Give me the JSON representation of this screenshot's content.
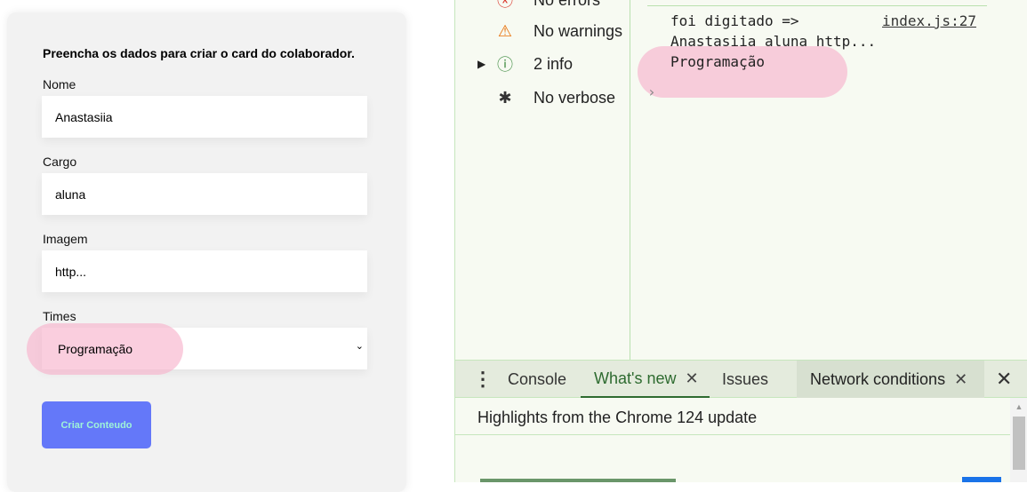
{
  "form": {
    "title": "Preencha os dados para criar o card do colaborador.",
    "fields": [
      {
        "label": "Nome",
        "value": "Anastasiia"
      },
      {
        "label": "Cargo",
        "value": "aluna"
      },
      {
        "label": "Imagem",
        "value": "http..."
      }
    ],
    "select": {
      "label": "Times",
      "value": "Programação"
    },
    "submit": "Criar Conteudo"
  },
  "devtools": {
    "sidebar": [
      {
        "icon": "error-icon",
        "label": "No errors"
      },
      {
        "icon": "warning-icon",
        "label": "No warnings"
      },
      {
        "icon": "info-icon",
        "label": "2 info"
      },
      {
        "icon": "bug-icon",
        "label": "No verbose"
      }
    ],
    "console": {
      "line1": "foi digitado =>",
      "source": "index.js:27",
      "line2": "Anastasiia aluna http...",
      "line3": "Programação"
    },
    "tabs": [
      {
        "label": "Console"
      },
      {
        "label": "What's new",
        "active": true
      },
      {
        "label": "Issues"
      },
      {
        "label": "Network conditions"
      }
    ],
    "drawer_heading": "Highlights from the Chrome 124 update",
    "accent": "#2e6b30"
  }
}
